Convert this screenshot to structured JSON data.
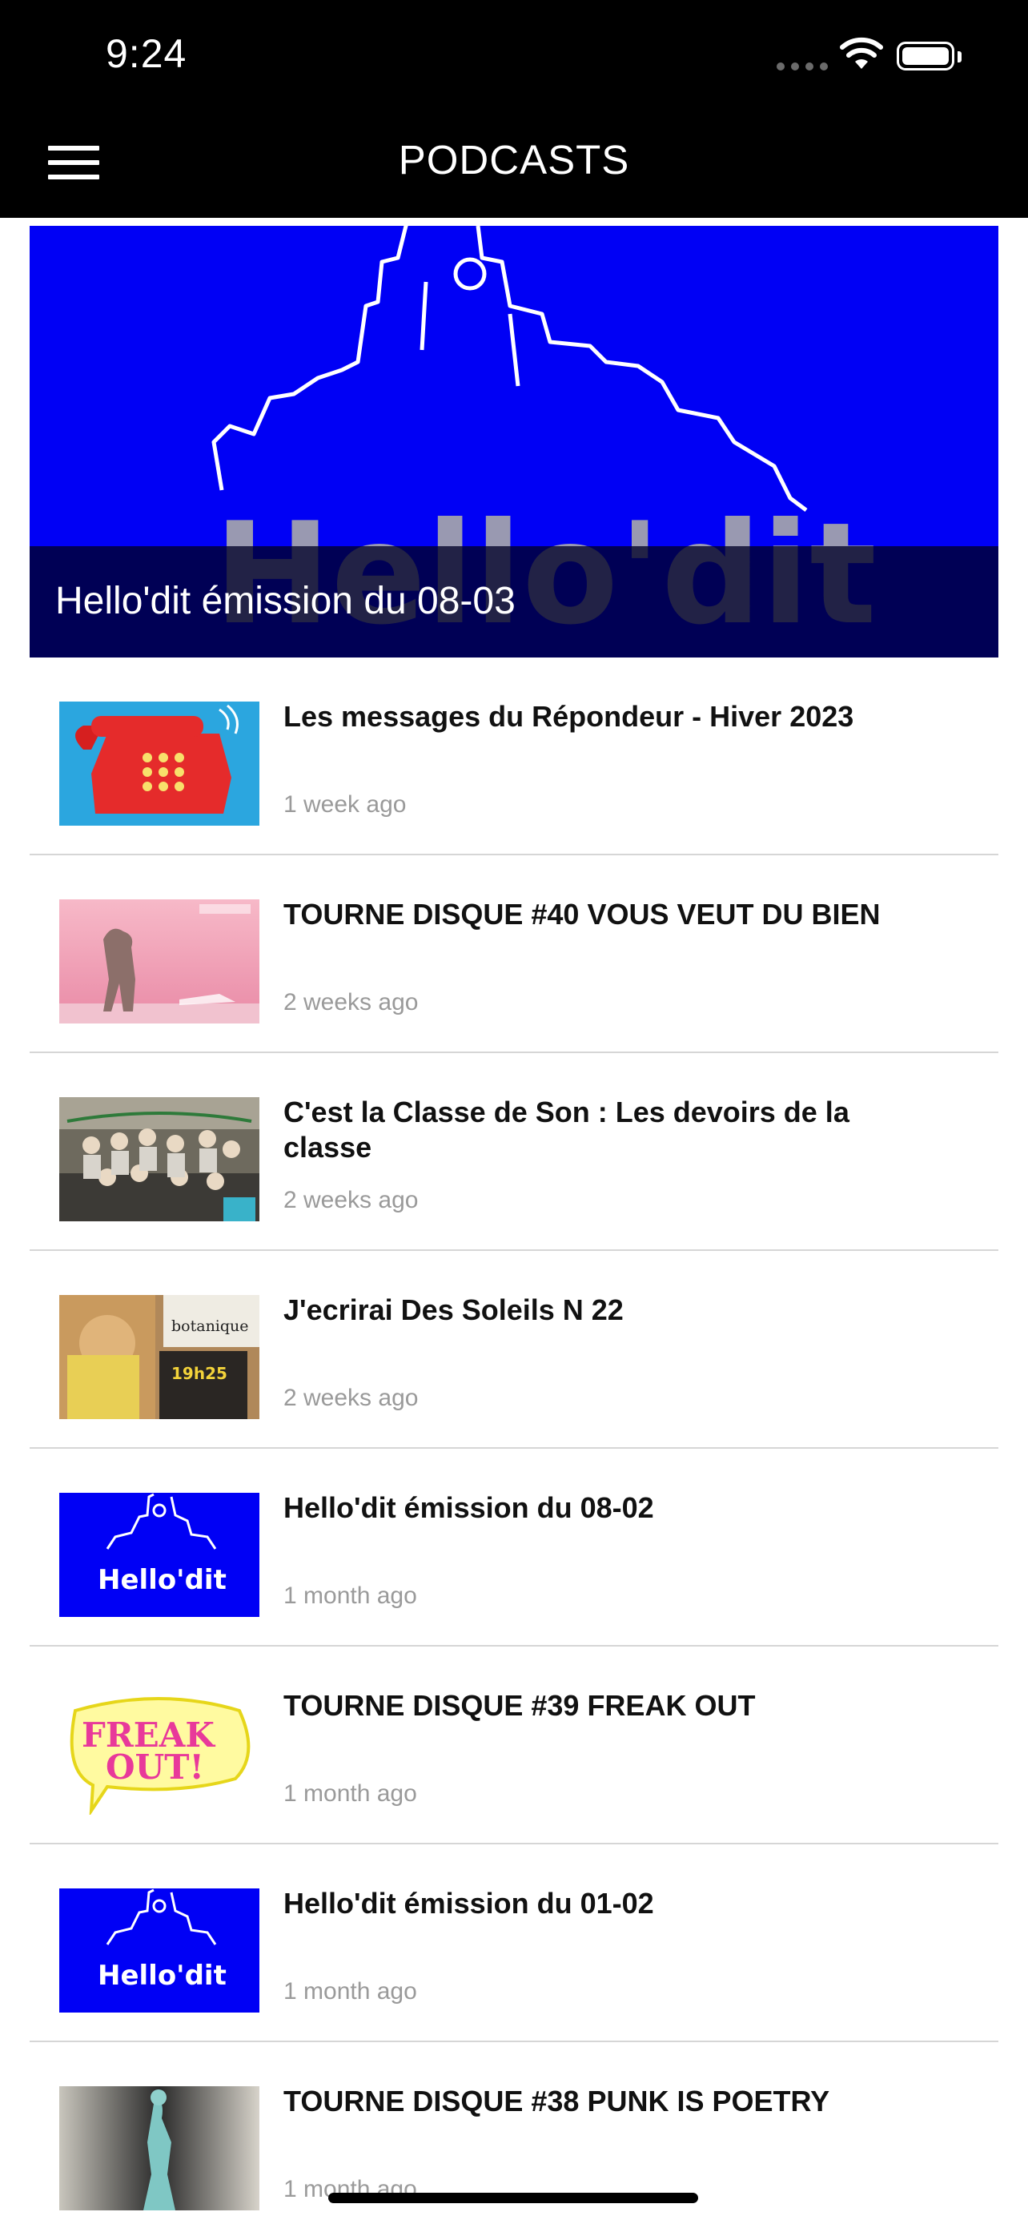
{
  "status_bar": {
    "time": "9:24"
  },
  "nav": {
    "title": "PODCASTS"
  },
  "featured": {
    "caption": "Hello'dit émission du 08-03",
    "image_text": "Hello'dit"
  },
  "episodes": [
    {
      "title": "Les messages du Répondeur - Hiver 2023",
      "date": "1 week ago",
      "thumb": "red-telephone"
    },
    {
      "title": "TOURNE DISQUE #40 VOUS VEUT DU BIEN",
      "date": "2 weeks ago",
      "thumb": "pink-poster"
    },
    {
      "title": "C'est la Classe de Son : Les devoirs de la classe",
      "date": "2 weeks ago",
      "thumb": "group-photo"
    },
    {
      "title": "J'ecrirai Des Soleils N 22",
      "date": "2 weeks ago",
      "thumb": "books"
    },
    {
      "title": "Hello'dit émission du 08-02",
      "date": "1 month ago",
      "thumb": "hellodit-logo"
    },
    {
      "title": "TOURNE DISQUE #39 FREAK OUT",
      "date": "1 month ago",
      "thumb": "freak-out"
    },
    {
      "title": "Hello'dit émission du 01-02",
      "date": "1 month ago",
      "thumb": "hellodit-logo"
    },
    {
      "title": "TOURNE DISQUE #38 PUNK IS POETRY",
      "date": "1 month ago",
      "thumb": "figure-photo"
    }
  ],
  "thumb_texts": {
    "hellodit": "Hello'dit",
    "freak": "FREAK",
    "out": "OUT!",
    "botanique": "botanique",
    "time": "19h25"
  },
  "colors": {
    "header_bg": "#000000",
    "hero_blue": "#0000f5",
    "date_gray": "#9a9a9a"
  }
}
